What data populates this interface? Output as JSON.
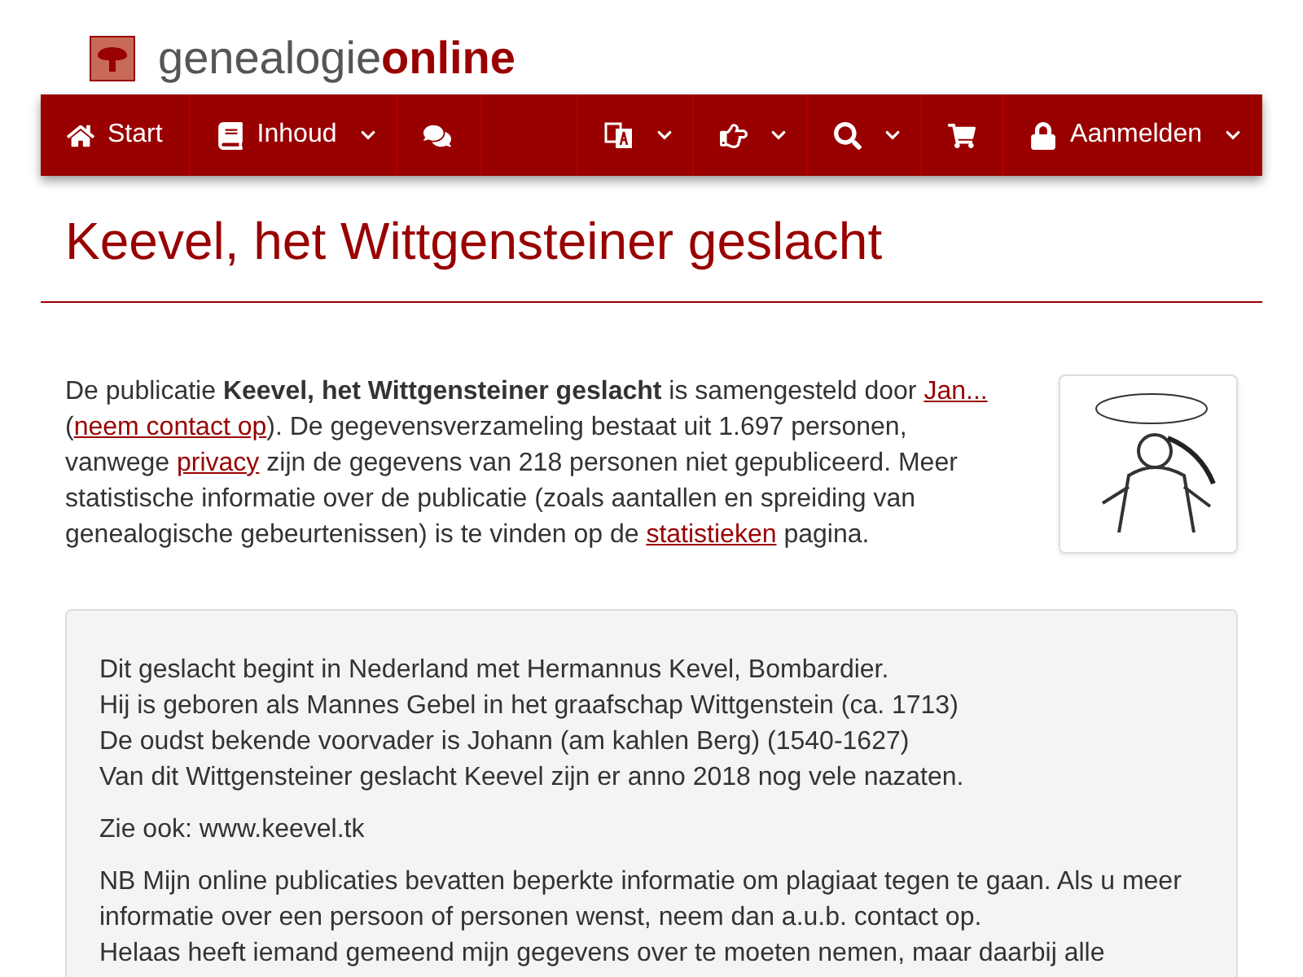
{
  "logo": {
    "text_plain": "genealogie",
    "text_bold": "online"
  },
  "nav": {
    "left": [
      {
        "label": "Start",
        "dropdown": false
      },
      {
        "label": "Inhoud",
        "dropdown": true
      },
      {
        "dropdown": false
      }
    ],
    "right": [
      {
        "dropdown": true
      },
      {
        "dropdown": true
      },
      {
        "dropdown": true
      },
      {
        "dropdown": false
      },
      {
        "label": "Aanmelden",
        "dropdown": true
      }
    ]
  },
  "title": "Keevel, het Wittgensteiner geslacht",
  "intro": [
    {
      "kind": "text",
      "text": "De publicatie "
    },
    {
      "kind": "bold",
      "text": "Keevel, het Wittgensteiner geslacht"
    },
    {
      "kind": "text",
      "text": " is samengesteld door "
    },
    {
      "kind": "link",
      "text": "Jan..."
    },
    {
      "kind": "text",
      "text": " ("
    },
    {
      "kind": "link",
      "text": "neem contact op"
    },
    {
      "kind": "text",
      "text": "). De gegevensverzameling bestaat uit 1.697 personen, vanwege "
    },
    {
      "kind": "link",
      "text": "privacy"
    },
    {
      "kind": "text",
      "text": " zijn de gegevens van 218 personen niet gepubliceerd. Meer statistische informatie over de publicatie (zoals aantallen en spreiding van genealogische gebeurtenissen) is te vinden op de "
    },
    {
      "kind": "link",
      "text": "statistieken"
    },
    {
      "kind": "text",
      "text": " pagina."
    }
  ],
  "description": [
    [
      "Dit geslacht begint in Nederland met Hermannus Kevel, Bombardier.",
      "Hij is geboren als Mannes Gebel in het graafschap Wittgenstein (ca. 1713)",
      "De oudst bekende voorvader is Johann (am kahlen Berg) (1540-1627)",
      "Van dit Wittgensteiner geslacht Keevel zijn er anno 2018 nog vele nazaten."
    ],
    [
      "Zie ook: www.keevel.tk"
    ],
    [
      "NB Mijn online publicaties bevatten beperkte informatie om plagiaat tegen te gaan. Als u meer informatie over een persoon of personen wenst, neem dan a.u.b. contact op.",
      "Helaas heeft iemand gemeend mijn gegevens over te moeten nemen, maar daarbij alle"
    ]
  ]
}
